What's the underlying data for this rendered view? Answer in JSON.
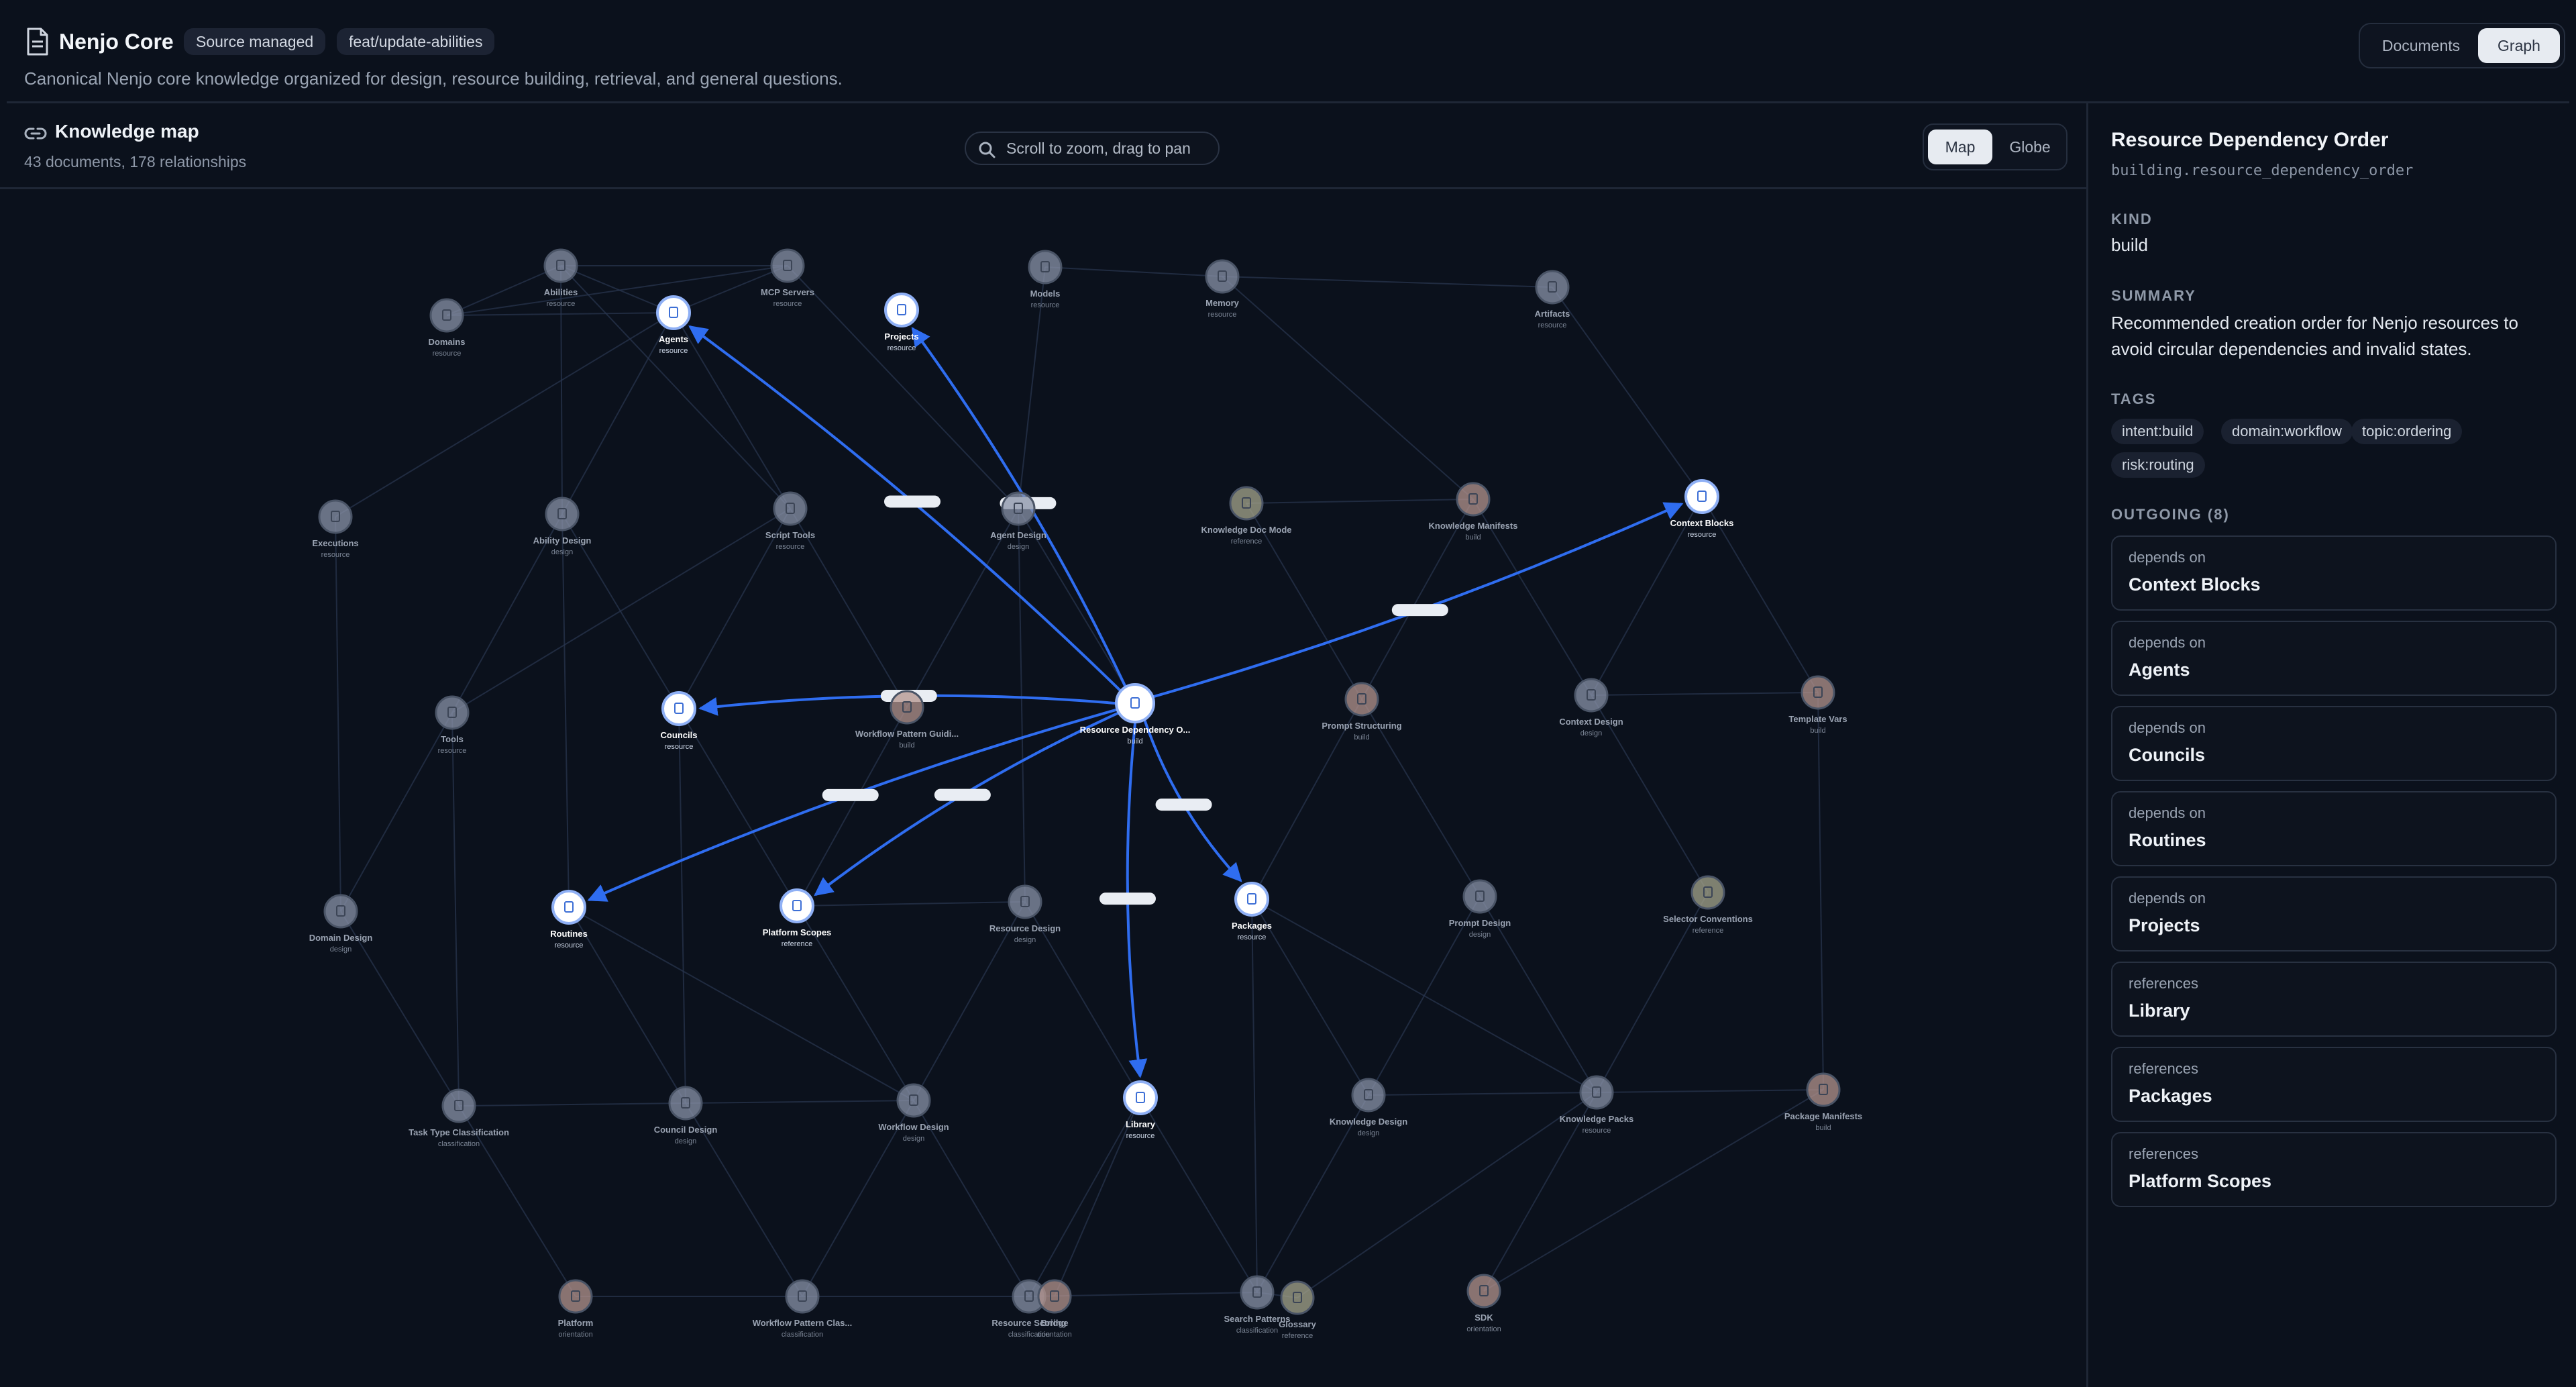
{
  "header": {
    "title": "Nenjo Core",
    "badges": [
      "Source managed",
      "feat/update-abilities"
    ],
    "description": "Canonical Nenjo core knowledge organized for design, resource building, retrieval, and general questions.",
    "view_tabs": [
      {
        "label": "Documents",
        "active": false
      },
      {
        "label": "Graph",
        "active": true
      }
    ]
  },
  "map": {
    "title": "Knowledge map",
    "subtitle": "43 documents, 178 relationships",
    "hint": "Scroll to zoom, drag to pan",
    "modes": [
      {
        "label": "Map",
        "active": true
      },
      {
        "label": "Globe",
        "active": false
      }
    ]
  },
  "graph": {
    "colors": {
      "bg": "#0b111c",
      "edge": "#2a3650",
      "highlight_edge": "#2f6df0",
      "node_dim": "#7c8598",
      "node_active": "#ffffff"
    },
    "selected": "Resource Dependency O...",
    "nodes": [
      {
        "label": "Abilities",
        "sub": "resource",
        "tint": "#8a93a8",
        "active": false
      },
      {
        "label": "MCP Servers",
        "sub": "resource",
        "tint": "#8a93a8",
        "active": false
      },
      {
        "label": "Models",
        "sub": "resource",
        "tint": "#8a93a8",
        "active": false
      },
      {
        "label": "Memory",
        "sub": "resource",
        "tint": "#8a93a8",
        "active": false
      },
      {
        "label": "Artifacts",
        "sub": "resource",
        "tint": "#8a93a8",
        "active": false
      },
      {
        "label": "Domains",
        "sub": "resource",
        "tint": "#8a93a8",
        "active": false
      },
      {
        "label": "Agents",
        "sub": "resource",
        "tint": "#ffffff",
        "active": true
      },
      {
        "label": "Projects",
        "sub": "resource",
        "tint": "#ffffff",
        "active": true
      },
      {
        "label": "Executions",
        "sub": "resource",
        "tint": "#8a93a8",
        "active": false
      },
      {
        "label": "Ability Design",
        "sub": "design",
        "tint": "#8a93a8",
        "active": false
      },
      {
        "label": "Script Tools",
        "sub": "resource",
        "tint": "#8a93a8",
        "active": false
      },
      {
        "label": "Agent Design",
        "sub": "design",
        "tint": "#8a93a8",
        "active": false
      },
      {
        "label": "Knowledge Doc Mode",
        "sub": "reference",
        "tint": "#a5a58c",
        "active": false
      },
      {
        "label": "Knowledge Manifests",
        "sub": "build",
        "tint": "#b4948d",
        "active": false
      },
      {
        "label": "Context Blocks",
        "sub": "resource",
        "tint": "#ffffff",
        "active": true
      },
      {
        "label": "Tools",
        "sub": "resource",
        "tint": "#8a93a8",
        "active": false
      },
      {
        "label": "Councils",
        "sub": "resource",
        "tint": "#ffffff",
        "active": true
      },
      {
        "label": "Workflow Pattern Guidi...",
        "sub": "build",
        "tint": "#b4948d",
        "active": false
      },
      {
        "label": "Resource Dependency O...",
        "sub": "build",
        "tint": "#ffffff",
        "active": true
      },
      {
        "label": "Prompt Structuring",
        "sub": "build",
        "tint": "#b4948d",
        "active": false
      },
      {
        "label": "Context Design",
        "sub": "design",
        "tint": "#8a93a8",
        "active": false
      },
      {
        "label": "Template Vars",
        "sub": "build",
        "tint": "#b4948d",
        "active": false
      },
      {
        "label": "Domain Design",
        "sub": "design",
        "tint": "#8a93a8",
        "active": false
      },
      {
        "label": "Routines",
        "sub": "resource",
        "tint": "#ffffff",
        "active": true
      },
      {
        "label": "Platform Scopes",
        "sub": "reference",
        "tint": "#ffffff",
        "active": true
      },
      {
        "label": "Resource Design",
        "sub": "design",
        "tint": "#8a93a8",
        "active": false
      },
      {
        "label": "Packages",
        "sub": "resource",
        "tint": "#ffffff",
        "active": true
      },
      {
        "label": "Prompt Design",
        "sub": "design",
        "tint": "#8a93a8",
        "active": false
      },
      {
        "label": "Selector Conventions",
        "sub": "reference",
        "tint": "#a5a58c",
        "active": false
      },
      {
        "label": "Task Type Classification",
        "sub": "classification",
        "tint": "#8a93a8",
        "active": false
      },
      {
        "label": "Council Design",
        "sub": "design",
        "tint": "#8a93a8",
        "active": false
      },
      {
        "label": "Workflow Design",
        "sub": "design",
        "tint": "#8a93a8",
        "active": false
      },
      {
        "label": "Library",
        "sub": "resource",
        "tint": "#ffffff",
        "active": true
      },
      {
        "label": "Knowledge Design",
        "sub": "design",
        "tint": "#8a93a8",
        "active": false
      },
      {
        "label": "Knowledge Packs",
        "sub": "resource",
        "tint": "#8a93a8",
        "active": false
      },
      {
        "label": "Package Manifests",
        "sub": "build",
        "tint": "#b4948d",
        "active": false
      },
      {
        "label": "Platform",
        "sub": "orientation",
        "tint": "#b4948d",
        "active": false
      },
      {
        "label": "Workflow Pattern Clas...",
        "sub": "classification",
        "tint": "#8a93a8",
        "active": false
      },
      {
        "label": "Resource Scoring",
        "sub": "classification",
        "tint": "#8a93a8",
        "active": false
      },
      {
        "label": "Bridge",
        "sub": "orientation",
        "tint": "#b4948d",
        "active": false
      },
      {
        "label": "Search Patterns",
        "sub": "classification",
        "tint": "#8a93a8",
        "active": false
      },
      {
        "label": "Glossary",
        "sub": "reference",
        "tint": "#a5a58c",
        "active": false
      },
      {
        "label": "SDK",
        "sub": "orientation",
        "tint": "#b4948d",
        "active": false
      }
    ]
  },
  "detail": {
    "title": "Resource Dependency Order",
    "id": "building.resource_dependency_order",
    "kind_label": "KIND",
    "kind": "build",
    "summary_label": "SUMMARY",
    "summary": "Recommended creation order for Nenjo resources to avoid circular dependencies and invalid states.",
    "tags_label": "TAGS",
    "tags": [
      "intent:build",
      "domain:workflow",
      "topic:ordering",
      "risk:routing"
    ],
    "outgoing_label": "OUTGOING (8)",
    "outgoing": [
      {
        "relation": "depends on",
        "target": "Context Blocks"
      },
      {
        "relation": "depends on",
        "target": "Agents"
      },
      {
        "relation": "depends on",
        "target": "Councils"
      },
      {
        "relation": "depends on",
        "target": "Routines"
      },
      {
        "relation": "depends on",
        "target": "Projects"
      },
      {
        "relation": "references",
        "target": "Library"
      },
      {
        "relation": "references",
        "target": "Packages"
      },
      {
        "relation": "references",
        "target": "Platform Scopes"
      }
    ]
  }
}
